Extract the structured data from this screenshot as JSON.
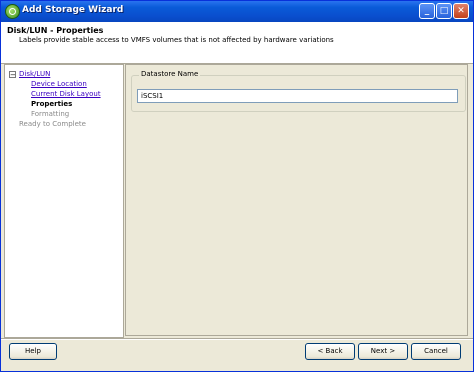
{
  "window": {
    "title": "Add Storage Wizard"
  },
  "header": {
    "title": "Disk/LUN - Properties",
    "subtitle": "Labels provide stable access to VMFS volumes that is not affected by hardware variations"
  },
  "nav": {
    "items": [
      {
        "label": "Disk/LUN",
        "state": "link"
      },
      {
        "label": "Device Location",
        "state": "link"
      },
      {
        "label": "Current Disk Layout",
        "state": "link"
      },
      {
        "label": "Properties",
        "state": "current"
      },
      {
        "label": "Formatting",
        "state": "disabled"
      },
      {
        "label": "Ready to Complete",
        "state": "disabled"
      }
    ]
  },
  "content": {
    "datastore_label": "Datastore Name",
    "datastore_value": "iSCSI1"
  },
  "footer": {
    "help": "Help",
    "back": "< Back",
    "next": "Next >",
    "cancel": "Cancel"
  },
  "colors": {
    "titlebar": "#0a5bd8",
    "link": "#3a00c0"
  }
}
